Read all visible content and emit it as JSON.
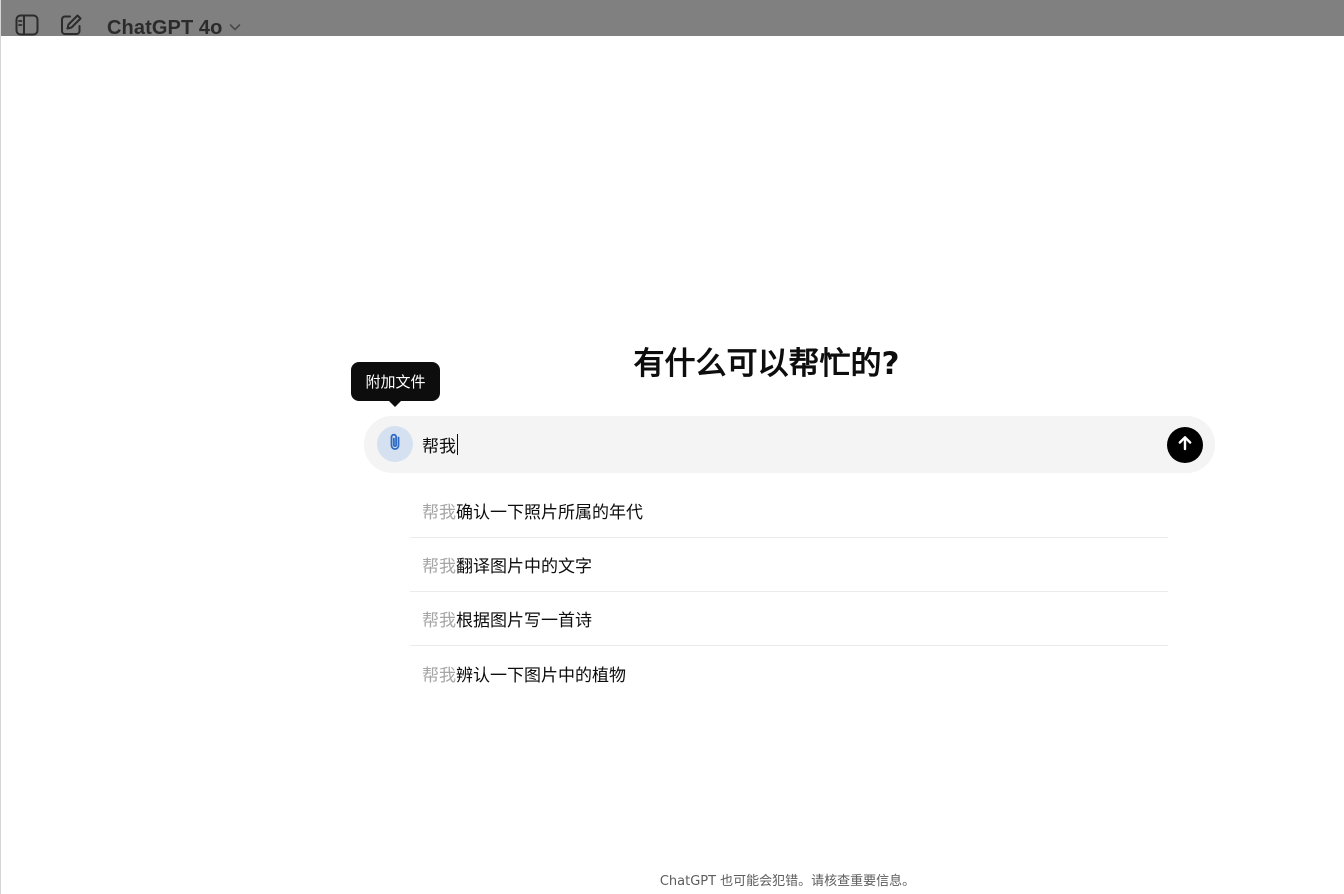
{
  "header": {
    "model_name": "ChatGPT 4o",
    "icons": [
      "sidebar-toggle-icon",
      "new-chat-icon",
      "chevron-down-icon"
    ]
  },
  "main": {
    "headline": "有什么可以帮忙的?",
    "tooltip": "附加文件",
    "composer": {
      "value": "帮我"
    },
    "suggestions": [
      {
        "prefix": "帮我",
        "text": "确认一下照片所属的年代"
      },
      {
        "prefix": "帮我",
        "text": "翻译图片中的文字"
      },
      {
        "prefix": "帮我",
        "text": "根据图片写一首诗"
      },
      {
        "prefix": "帮我",
        "text": "辨认一下图片中的植物"
      }
    ]
  },
  "footer": {
    "disclaimer": "ChatGPT 也可能会犯错。请核查重要信息。"
  },
  "colors": {
    "topbar_overlay": "#808080",
    "composer_bg": "#f4f4f4",
    "attach_bg": "#d5e1f1",
    "attach_icon": "#2f6bc4",
    "send_bg": "#000000",
    "suggestion_prefix": "#a6a6a6"
  }
}
